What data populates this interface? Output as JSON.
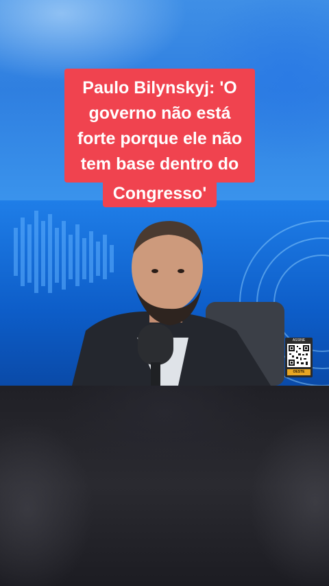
{
  "headline": {
    "lines": [
      "Paulo Bilynskyj: 'O",
      "governo não está",
      "forte porque ele não",
      "tem base dentro do",
      "Congresso'"
    ]
  },
  "qr_badge": {
    "top_label": "ASSINE",
    "bottom_label": "OESTE"
  },
  "colors": {
    "headline_bg": "#f0434f",
    "headline_text": "#ffffff",
    "studio_blue": "#1f7ee8",
    "badge_accent": "#e8a623"
  }
}
